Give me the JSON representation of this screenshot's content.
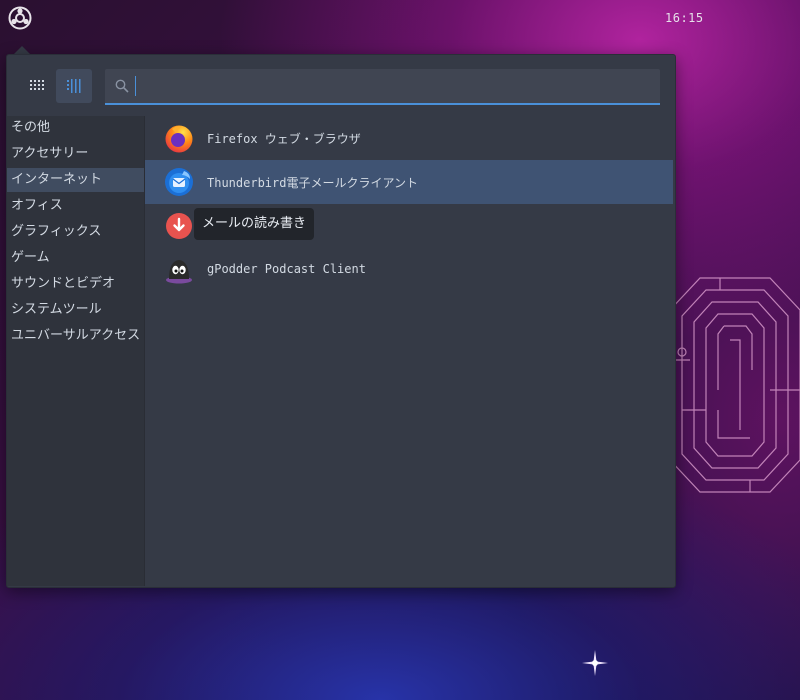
{
  "topbar": {
    "logo_icon": "ubuntu-budgie-logo-icon",
    "clock": "16:15"
  },
  "menu": {
    "view_buttons": [
      {
        "name": "grid-view",
        "icon": "grid-icon",
        "selected": false
      },
      {
        "name": "list-view",
        "icon": "list-icon",
        "selected": true
      }
    ],
    "search": {
      "value": "",
      "placeholder": "",
      "icon": "search-icon"
    },
    "categories": [
      {
        "label": "その他",
        "selected": false
      },
      {
        "label": "アクセサリー",
        "selected": false
      },
      {
        "label": "インターネット",
        "selected": true
      },
      {
        "label": "オフィス",
        "selected": false
      },
      {
        "label": "グラフィックス",
        "selected": false
      },
      {
        "label": "ゲーム",
        "selected": false
      },
      {
        "label": "サウンドとビデオ",
        "selected": false
      },
      {
        "label": "システムツール",
        "selected": false
      },
      {
        "label": "ユニバーサルアクセス",
        "selected": false
      }
    ],
    "apps": [
      {
        "label": "Firefox ウェブ・ブラウザ",
        "icon": "firefox-icon",
        "selected": false
      },
      {
        "label": "Thunderbird電子メールクライアント",
        "icon": "thunderbird-icon",
        "selected": true
      },
      {
        "label": "",
        "icon": "download-icon",
        "selected": false
      },
      {
        "label": "gPodder Podcast Client",
        "icon": "gpodder-icon",
        "selected": false
      }
    ],
    "tooltip": "メールの読み書き"
  },
  "colors": {
    "accent": "#4a90d9",
    "menu_bg": "#353a46",
    "sidebar_bg": "#2f333c",
    "selected_row": "#3f5373",
    "selected_category": "#404c60",
    "text": "#d3dae3"
  }
}
